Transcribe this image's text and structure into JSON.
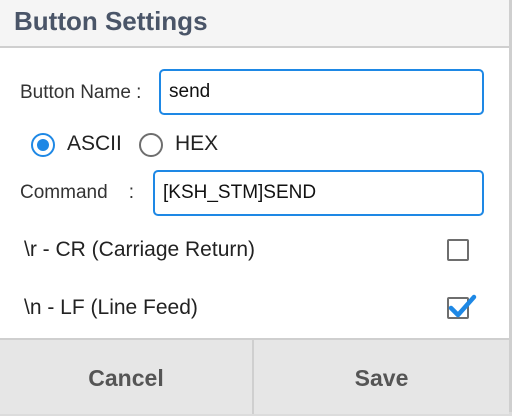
{
  "dialog": {
    "title": "Button Settings"
  },
  "form": {
    "button_name_label": "Button Name :",
    "button_name_value": "send",
    "mode_options": [
      {
        "label": "ASCII",
        "checked": true
      },
      {
        "label": "HEX",
        "checked": false
      }
    ],
    "command_label": "Command    :",
    "command_value": "[KSH_STM]SEND",
    "cr_label": "\\r - CR (Carriage Return)",
    "cr_checked": false,
    "lf_label": "\\n - LF (Line Feed)",
    "lf_checked": true
  },
  "buttons": {
    "cancel_label": "Cancel",
    "save_label": "Save"
  },
  "colors": {
    "accent": "#1e88e5",
    "title": "#4a5568"
  }
}
